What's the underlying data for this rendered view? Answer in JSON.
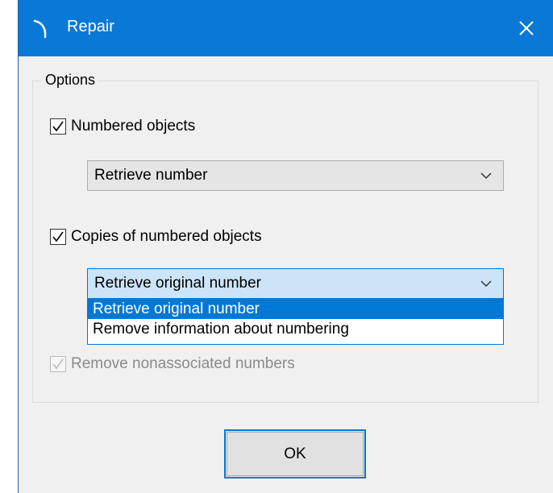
{
  "window": {
    "title": "Repair",
    "icon": "app-logo-icon",
    "close_icon": "close-icon",
    "titlebar_color": "#0a78d7"
  },
  "options": {
    "group_label": "Options",
    "numbered_objects": {
      "label": "Numbered objects",
      "checked": true,
      "select_value": "Retrieve number"
    },
    "copies_of_numbered_objects": {
      "label": "Copies of numbered objects",
      "checked": true,
      "select_value": "Retrieve original number",
      "dropdown_open": true,
      "dropdown_options": [
        "Retrieve original number",
        "Remove information about numbering"
      ],
      "selected_index": 0
    },
    "remove_nonassociated": {
      "label": "Remove nonassociated numbers",
      "checked": true,
      "disabled": true
    }
  },
  "buttons": {
    "ok_label": "OK"
  },
  "colors": {
    "accent": "#0078d7",
    "dialog_bg": "#f0f0f0",
    "selection": "#0078d7"
  }
}
